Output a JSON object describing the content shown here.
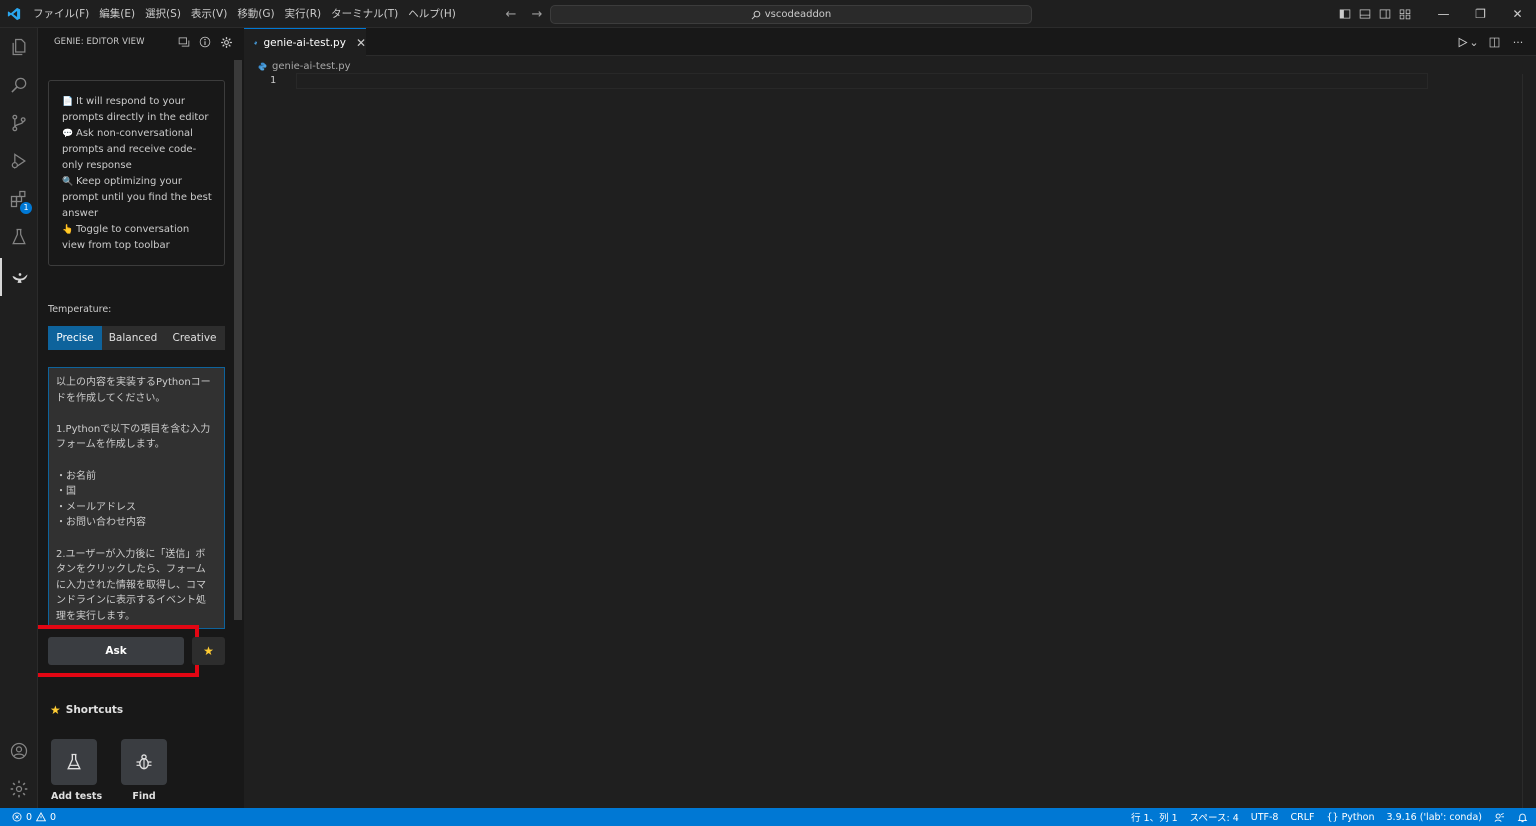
{
  "titlebar": {
    "menus": [
      "ファイル(F)",
      "編集(E)",
      "選択(S)",
      "表示(V)",
      "移動(G)",
      "実行(R)",
      "ターミナル(T)",
      "ヘルプ(H)"
    ],
    "search_text": "vscodeaddon",
    "nav_back": "←",
    "nav_forward": "→",
    "window_minimize": "—",
    "window_restore": "❐",
    "window_close": "✕"
  },
  "activitybar": {
    "extensions_badge": "1"
  },
  "sidebar": {
    "title": "GENIE: EDITOR VIEW",
    "info": [
      {
        "emoji": "📄",
        "text": "It will respond to your prompts directly in the editor"
      },
      {
        "emoji": "💬",
        "text": "Ask non-conversational prompts and receive code-only response"
      },
      {
        "emoji": "🔍",
        "text": "Keep optimizing your prompt until you find the best answer"
      },
      {
        "emoji": "👆",
        "text": "Toggle to conversation view from top toolbar"
      }
    ],
    "temperature_label": "Temperature:",
    "temperature_options": [
      "Precise",
      "Balanced",
      "Creative"
    ],
    "temperature_selected": "Precise",
    "prompt_lines": [
      "以上の内容を実装するPythonコー",
      "ドを作成してください。",
      "",
      "1.Pythonで以下の項目を含む入力",
      "フォームを作成します。",
      "",
      "・お名前",
      "・国",
      "・メールアドレス",
      "・お問い合わせ内容",
      "",
      "2.ユーザーが入力後に「送信」ボ",
      "タンをクリックしたら、フォーム",
      "に入力された情報を取得し、コマ",
      "ンドラインに表示するイベント処",
      "理を実行します。"
    ],
    "ask_label": "Ask",
    "favorite_icon": "★",
    "shortcuts_title": "Shortcuts",
    "shortcuts": [
      "Add tests",
      "Find"
    ]
  },
  "editor": {
    "tab_label": "genie-ai-test.py",
    "tab_close": "✕",
    "breadcrumb_file": "genie-ai-test.py",
    "line_number": "1",
    "more_actions": "···",
    "run_dropdown": "⌄"
  },
  "statusbar": {
    "errors": "0",
    "warnings": "0",
    "position": "行 1、列 1",
    "spaces": "スペース: 4",
    "encoding": "UTF-8",
    "eol": "CRLF",
    "language": "Python",
    "interpreter": "3.9.16 ('lab': conda)"
  },
  "colors": {
    "accent": "#0078d4",
    "button_active": "#0e639c",
    "highlight_box": "#e30613"
  }
}
